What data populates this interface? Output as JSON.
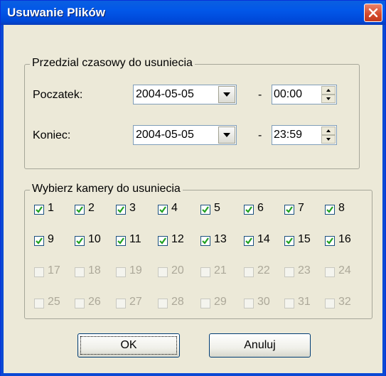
{
  "dialog": {
    "title": "Usuwanie Plików"
  },
  "time_range": {
    "legend": "Przedzial czasowy do usuniecia",
    "start_label": "Poczatek:",
    "start_date": "2004-05-05",
    "start_time": "00:00",
    "end_label": "Koniec:",
    "end_date": "2004-05-05",
    "end_time": "23:59",
    "separator": "-"
  },
  "cameras": {
    "legend": "Wybierz kamery do usuniecia",
    "items": [
      {
        "label": "1",
        "checked": true,
        "enabled": true
      },
      {
        "label": "2",
        "checked": true,
        "enabled": true
      },
      {
        "label": "3",
        "checked": true,
        "enabled": true
      },
      {
        "label": "4",
        "checked": true,
        "enabled": true
      },
      {
        "label": "5",
        "checked": true,
        "enabled": true
      },
      {
        "label": "6",
        "checked": true,
        "enabled": true
      },
      {
        "label": "7",
        "checked": true,
        "enabled": true
      },
      {
        "label": "8",
        "checked": true,
        "enabled": true
      },
      {
        "label": "9",
        "checked": true,
        "enabled": true
      },
      {
        "label": "10",
        "checked": true,
        "enabled": true
      },
      {
        "label": "11",
        "checked": true,
        "enabled": true
      },
      {
        "label": "12",
        "checked": true,
        "enabled": true
      },
      {
        "label": "13",
        "checked": true,
        "enabled": true
      },
      {
        "label": "14",
        "checked": true,
        "enabled": true
      },
      {
        "label": "15",
        "checked": true,
        "enabled": true
      },
      {
        "label": "16",
        "checked": true,
        "enabled": true
      },
      {
        "label": "17",
        "checked": false,
        "enabled": false
      },
      {
        "label": "18",
        "checked": false,
        "enabled": false
      },
      {
        "label": "19",
        "checked": false,
        "enabled": false
      },
      {
        "label": "20",
        "checked": false,
        "enabled": false
      },
      {
        "label": "21",
        "checked": false,
        "enabled": false
      },
      {
        "label": "22",
        "checked": false,
        "enabled": false
      },
      {
        "label": "23",
        "checked": false,
        "enabled": false
      },
      {
        "label": "24",
        "checked": false,
        "enabled": false
      },
      {
        "label": "25",
        "checked": false,
        "enabled": false
      },
      {
        "label": "26",
        "checked": false,
        "enabled": false
      },
      {
        "label": "27",
        "checked": false,
        "enabled": false
      },
      {
        "label": "28",
        "checked": false,
        "enabled": false
      },
      {
        "label": "29",
        "checked": false,
        "enabled": false
      },
      {
        "label": "30",
        "checked": false,
        "enabled": false
      },
      {
        "label": "31",
        "checked": false,
        "enabled": false
      },
      {
        "label": "32",
        "checked": false,
        "enabled": false
      }
    ]
  },
  "buttons": {
    "ok": "OK",
    "cancel": "Anuluj"
  }
}
